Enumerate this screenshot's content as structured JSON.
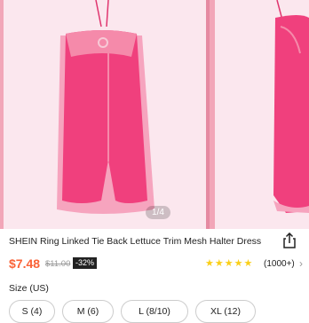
{
  "gallery": {
    "counter": "1/4"
  },
  "product": {
    "title": "SHEIN Ring Linked Tie Back Lettuce Trim Mesh Halter Dress",
    "price": "$7.48",
    "retail_price": "$11.00",
    "discount": "-32%",
    "rating_stars": 4.5,
    "review_count": "(1000+)"
  },
  "size": {
    "label": "Size (US)",
    "options": [
      "S (4)",
      "M (6)",
      "L (8/10)",
      "XL (12)"
    ]
  },
  "colors": {
    "price": "#fa6338",
    "star": "#facf19",
    "dress": "#f0407d",
    "backdrop": "#f2a6b8"
  },
  "icons": {
    "share": "share-icon",
    "arrow": "chevron-right-icon",
    "star": "star-icon"
  }
}
